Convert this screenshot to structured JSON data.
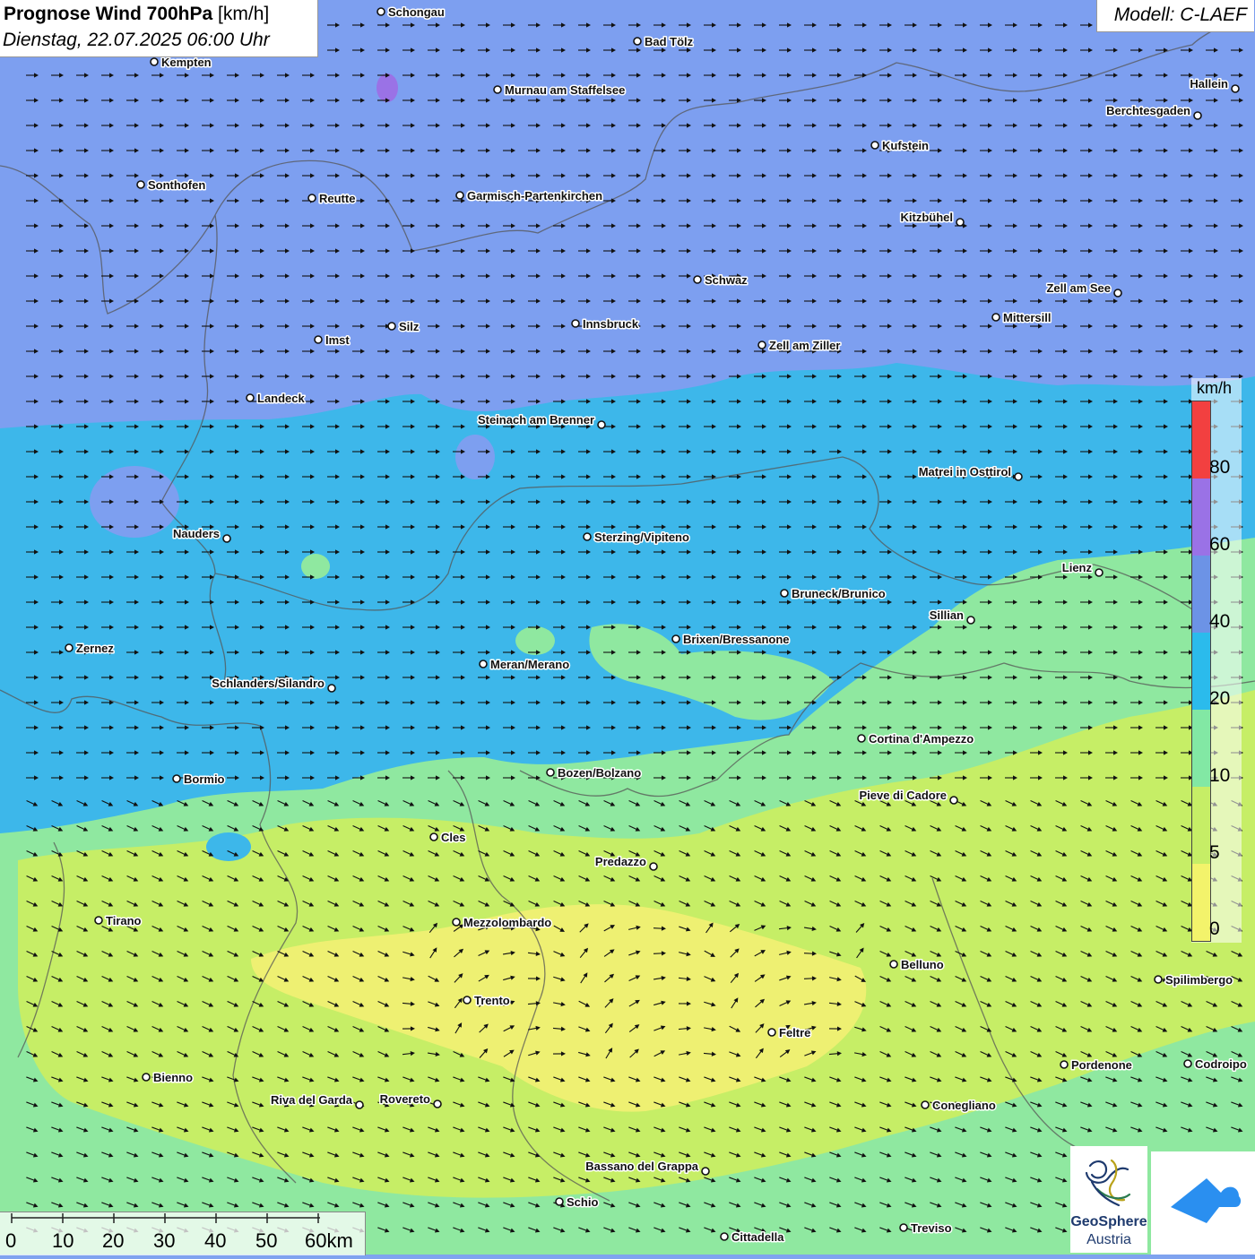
{
  "header": {
    "title": "Prognose Wind 700hPa",
    "unit": "[km/h]",
    "datetime": "Dienstag, 22.07.2025 06:00 Uhr",
    "model": "Modell: C-LAEF"
  },
  "legend": {
    "unit": "km/h",
    "labels": [
      "80",
      "60",
      "40",
      "20",
      "10",
      "5",
      "0"
    ],
    "colors": [
      "#f24040",
      "#9a72e6",
      "#6c93e6",
      "#2bbbec",
      "#82e8a4",
      "#c6ee66",
      "#f3f36b"
    ]
  },
  "colors": {
    "purple_zone": "#7d9ff0",
    "blue_zone": "#3db7ea",
    "green_zone": "#8fe8a0",
    "yellow_zone": "#eef072"
  },
  "cities": [
    {
      "name": "Schongau",
      "side": "right"
    },
    {
      "name": "Bad Tölz",
      "side": "right"
    },
    {
      "name": "Kempten",
      "side": "right"
    },
    {
      "name": "Murnau am Staffelsee",
      "side": "right"
    },
    {
      "name": "Hallein",
      "side": "left"
    },
    {
      "name": "Berchtesgaden",
      "side": "left"
    },
    {
      "name": "Kufstein",
      "side": "right"
    },
    {
      "name": "Sonthofen",
      "side": "right"
    },
    {
      "name": "Reutte",
      "side": "right"
    },
    {
      "name": "Garmisch-Partenkirchen",
      "side": "right"
    },
    {
      "name": "Kitzbühel",
      "side": "left"
    },
    {
      "name": "Schwaz",
      "side": "right"
    },
    {
      "name": "Zell am See",
      "side": "left"
    },
    {
      "name": "Innsbruck",
      "side": "right"
    },
    {
      "name": "Mittersill",
      "side": "right"
    },
    {
      "name": "Silz",
      "side": "right"
    },
    {
      "name": "Imst",
      "side": "right"
    },
    {
      "name": "Zell am Ziller",
      "side": "right"
    },
    {
      "name": "Landeck",
      "side": "right"
    },
    {
      "name": "Steinach am Brenner",
      "side": "left"
    },
    {
      "name": "Matrei in Osttirol",
      "side": "left"
    },
    {
      "name": "Nauders",
      "side": "left"
    },
    {
      "name": "Sterzing/Vipiteno",
      "side": "right"
    },
    {
      "name": "Lienz",
      "side": "left"
    },
    {
      "name": "Bruneck/Brunico",
      "side": "right"
    },
    {
      "name": "Sillian",
      "side": "left"
    },
    {
      "name": "Brixen/Bressanone",
      "side": "right"
    },
    {
      "name": "Zernez",
      "side": "right"
    },
    {
      "name": "Meran/Merano",
      "side": "right"
    },
    {
      "name": "Schlanders/Silandro",
      "side": "left"
    },
    {
      "name": "Cortina d'Ampezzo",
      "side": "right"
    },
    {
      "name": "Bozen/Bolzano",
      "side": "right"
    },
    {
      "name": "Bormio",
      "side": "right"
    },
    {
      "name": "Pieve di Cadore",
      "side": "left"
    },
    {
      "name": "Cles",
      "side": "right"
    },
    {
      "name": "Predazzo",
      "side": "left"
    },
    {
      "name": "Tirano",
      "side": "right"
    },
    {
      "name": "Mezzolombardo",
      "side": "right"
    },
    {
      "name": "Belluno",
      "side": "right"
    },
    {
      "name": "Spilimbergo",
      "side": "right"
    },
    {
      "name": "Trento",
      "side": "right"
    },
    {
      "name": "Feltre",
      "side": "right"
    },
    {
      "name": "Pordenone",
      "side": "right"
    },
    {
      "name": "Codroipo",
      "side": "right"
    },
    {
      "name": "Bienno",
      "side": "right"
    },
    {
      "name": "Riva del Garda",
      "side": "left"
    },
    {
      "name": "Rovereto",
      "side": "left"
    },
    {
      "name": "Conegliano",
      "side": "right"
    },
    {
      "name": "Bassano del Grappa",
      "side": "left"
    },
    {
      "name": "Schio",
      "side": "right"
    },
    {
      "name": "Treviso",
      "side": "right"
    },
    {
      "name": "Cittadella",
      "side": "right"
    }
  ],
  "scale": {
    "labels": [
      "0",
      "10",
      "20",
      "30",
      "40",
      "50",
      "60km"
    ]
  },
  "logos": {
    "geosphere_line1": "GeoSphere",
    "geosphere_line2": "Austria"
  }
}
